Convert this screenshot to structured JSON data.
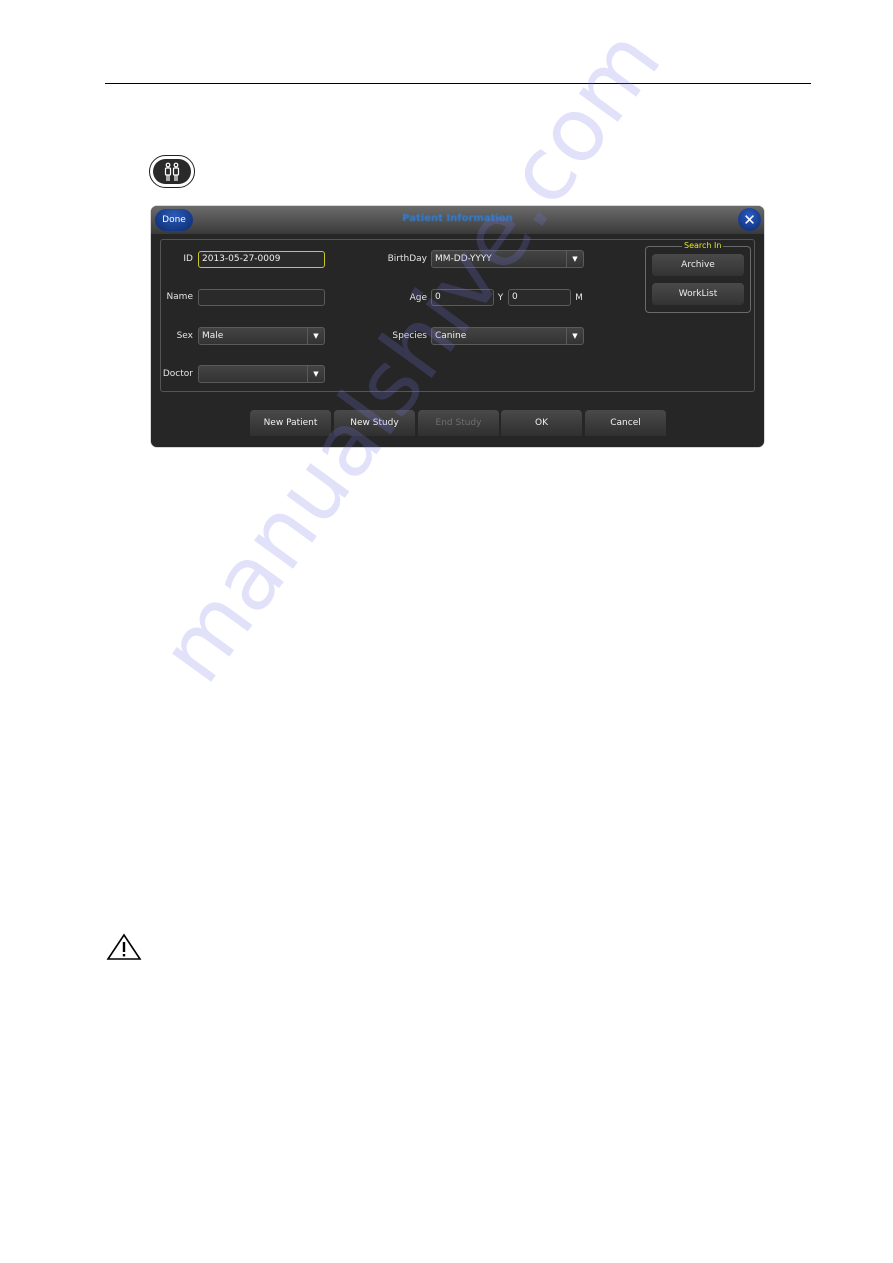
{
  "dialog": {
    "title": "Patient Information",
    "done_label": "Done",
    "close_icon": "close-icon",
    "fields": {
      "id": {
        "label": "ID",
        "value": "2013-05-27-0009"
      },
      "name": {
        "label": "Name",
        "value": ""
      },
      "sex": {
        "label": "Sex",
        "value": "Male"
      },
      "doctor": {
        "label": "Doctor",
        "value": ""
      },
      "birthday": {
        "label": "BirthDay",
        "value": "MM-DD-YYYY"
      },
      "age": {
        "label": "Age",
        "years": "0",
        "years_unit": "Y",
        "months": "0",
        "months_unit": "M"
      },
      "species": {
        "label": "Species",
        "value": "Canine"
      }
    },
    "search_in": {
      "legend": "Search In",
      "archive_label": "Archive",
      "worklist_label": "WorkList"
    },
    "buttons": {
      "new_patient": "New Patient",
      "new_study": "New Study",
      "end_study": "End Study",
      "ok": "OK",
      "cancel": "Cancel"
    },
    "dropdown_arrow": "▼"
  },
  "icons": {
    "patient_key": "patient-icon",
    "warning": "warning-icon"
  },
  "watermark": "manualshive.com",
  "colors": {
    "title": "#2f7fd6",
    "accent_blue": "#0c2a6e",
    "legend": "#e8e820",
    "active_border": "#c8c82a"
  }
}
